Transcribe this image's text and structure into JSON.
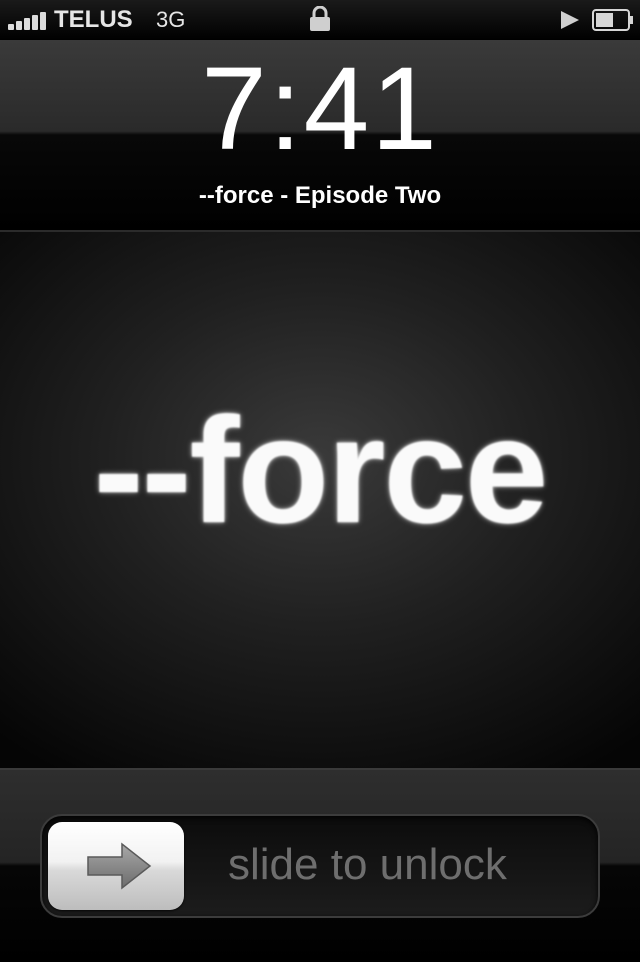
{
  "status_bar": {
    "carrier": "TELUS",
    "network": "3G",
    "icons": [
      "signal-icon",
      "lock-icon",
      "play-icon",
      "battery-icon"
    ],
    "signal_bars": 5,
    "battery_level": 0.55
  },
  "lock_screen": {
    "time": "7:41",
    "now_playing": "--force - Episode Two",
    "artwork_text": "--force"
  },
  "unlock": {
    "label": "slide to unlock",
    "knob_icon": "arrow-right-icon"
  },
  "colors": {
    "background": "#000000",
    "text": "#ffffff",
    "slider_label": "#6e6e6e"
  }
}
